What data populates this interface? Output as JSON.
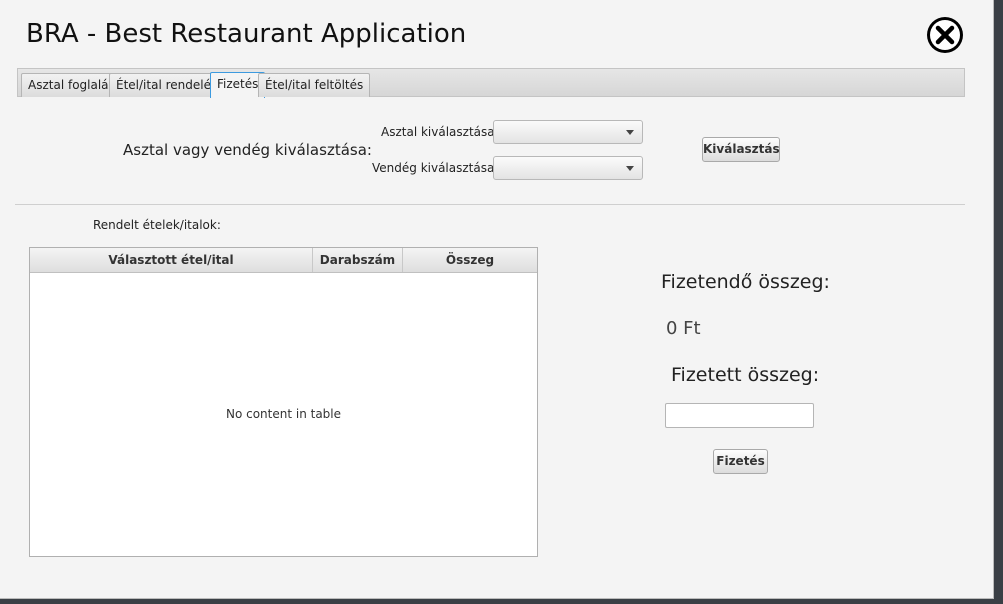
{
  "app": {
    "title": "BRA - Best Restaurant Application"
  },
  "tabs": [
    {
      "label": "Asztal foglalás"
    },
    {
      "label": "Étel/ital rendelés"
    },
    {
      "label": "Fizetés",
      "active": true
    },
    {
      "label": "Étel/ital feltöltés"
    }
  ],
  "selection": {
    "heading": "Asztal vagy vendég kiválasztása:",
    "table_label": "Asztal kiválasztása:",
    "table_value": "",
    "guest_label": "Vendég kiválasztása:",
    "guest_value": "",
    "select_button": "Kiválasztás"
  },
  "orders": {
    "heading": "Rendelt ételek/italok:",
    "columns": [
      "Választott étel/ital",
      "Darabszám",
      "Összeg"
    ],
    "rows": [],
    "empty_message": "No content in table"
  },
  "payment": {
    "due_label": "Fizetendő összeg:",
    "due_amount": "0 Ft",
    "paid_label": "Fizetett összeg:",
    "paid_value": "",
    "pay_button": "Fizetés"
  },
  "colors": {
    "active_tab_border": "#3c9adf",
    "close_icon_bg": "#000000"
  }
}
